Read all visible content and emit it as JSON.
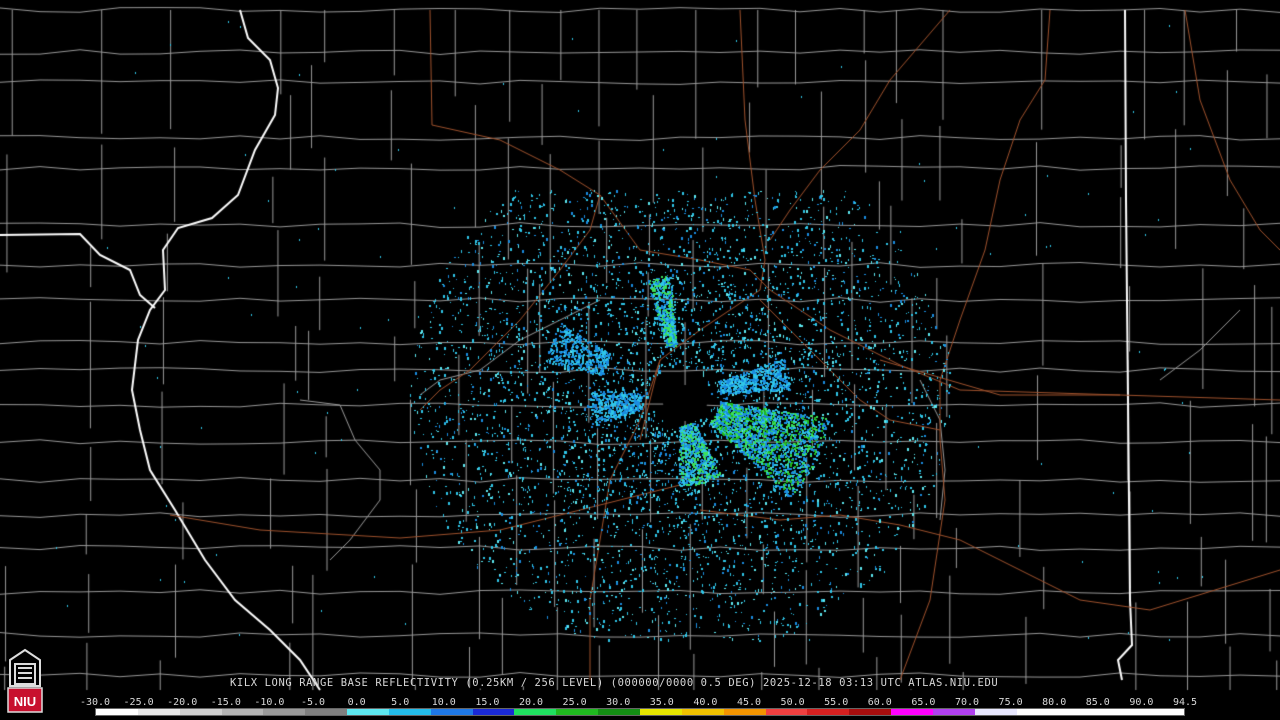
{
  "product_title": "KILX LONG RANGE BASE REFLECTIVITY (0.25KM / 256 LEVEL) (000000/0000 0.5 DEG) 2025-12-18 03:13 UTC  ATLAS.NIU.EDU",
  "scale": {
    "labels": [
      "-30.0",
      "-25.0",
      "-20.0",
      "-15.0",
      "-10.0",
      "-5.0",
      "0.0",
      "5.0",
      "10.0",
      "15.0",
      "20.0",
      "25.0",
      "30.0",
      "35.0",
      "40.0",
      "45.0",
      "50.0",
      "55.0",
      "60.0",
      "65.0",
      "70.0",
      "75.0",
      "80.0",
      "85.0",
      "90.0",
      "94.5"
    ],
    "colors": [
      "#ffffff",
      "#e8e8e8",
      "#cfcfcf",
      "#b4b4b4",
      "#9a9a9a",
      "#808080",
      "#5de8f0",
      "#23bcea",
      "#1e78e6",
      "#1a2ad6",
      "#1fe060",
      "#1fb91f",
      "#148e14",
      "#e6e600",
      "#f0c200",
      "#f29400",
      "#f04040",
      "#d62020",
      "#a80e0e",
      "#ff00ff",
      "#b040f0",
      "#e8e8ff",
      "#ffffff",
      "#ffffff",
      "#ffffff",
      "#ffffff"
    ]
  },
  "logo_text": "NIU",
  "colors": {
    "background": "#000000",
    "county_lines": "#9a9a9a",
    "state_lines": "#ffffff",
    "highways": "#a0522d",
    "echo_light": "#2fc6e8",
    "echo_mid": "#1a8ce0",
    "echo_strong": "#3ce05a"
  }
}
